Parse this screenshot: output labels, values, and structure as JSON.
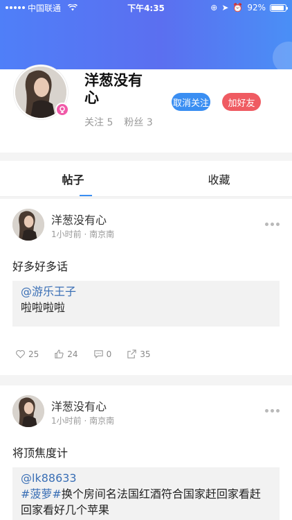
{
  "status_bar": {
    "carrier": "中国联通",
    "time": "下午4:35",
    "battery": "92%",
    "battery_level": 0.92
  },
  "profile": {
    "nickname": "洋葱没有心",
    "following_label": "关注",
    "following_count": "5",
    "fans_label": "粉丝",
    "fans_count": "3",
    "unfollow_label": "取消关注",
    "add_friend_label": "加好友"
  },
  "tabs": [
    {
      "label": "帖子"
    },
    {
      "label": "收藏"
    }
  ],
  "posts": [
    {
      "author": "洋葱没有心",
      "time": "1小时前",
      "location": "南京南",
      "text": "好多好多话",
      "quote_mention": "@游乐王子",
      "quote_text": "啦啦啦啦",
      "likes": "25",
      "thumbs": "24",
      "comments": "0",
      "shares": "35"
    },
    {
      "author": "洋葱没有心",
      "time": "1小时前",
      "location": "南京南",
      "text": "将顶焦度计",
      "quote_mention": "@lk88633",
      "quote_tag": "#菠萝#",
      "quote_text": "换个房间名法国红酒符合国家赶回家看赶回家看好几个苹果"
    }
  ],
  "colors": {
    "accent": "#3a8ef2",
    "add_friend": "#ef5b62",
    "badge": "#f05aa8"
  }
}
